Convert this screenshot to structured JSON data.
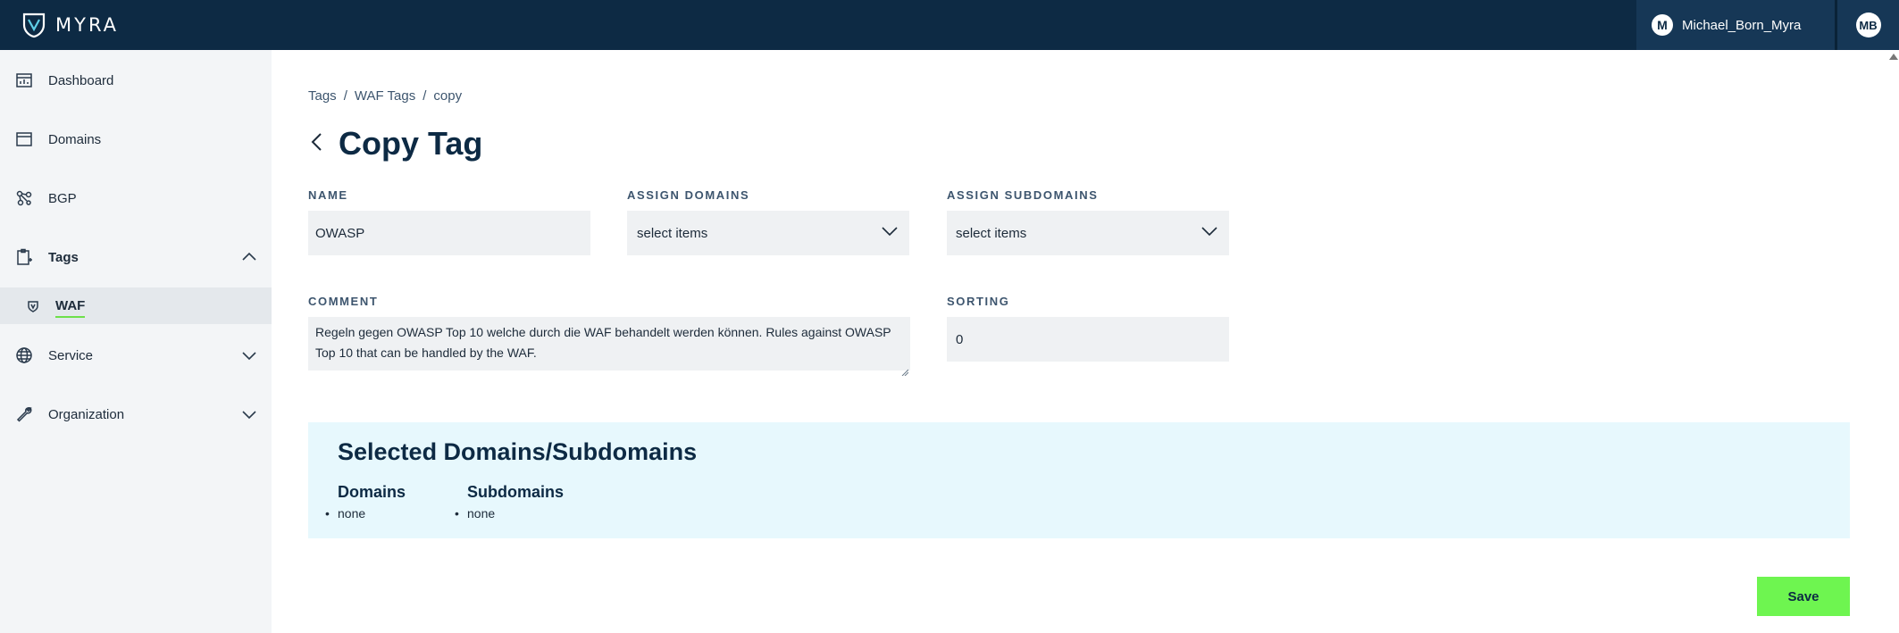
{
  "header": {
    "logo_text": "MYRA",
    "user_avatar_letter": "M",
    "user_name": "Michael_Born_Myra",
    "user_initials": "MB"
  },
  "sidebar": {
    "items": [
      {
        "label": "Dashboard",
        "icon": "dashboard-icon"
      },
      {
        "label": "Domains",
        "icon": "domains-icon"
      },
      {
        "label": "BGP",
        "icon": "bgp-icon"
      },
      {
        "label": "Tags",
        "icon": "tags-icon",
        "expanded": true
      },
      {
        "label": "Service",
        "icon": "service-icon",
        "expanded": false
      },
      {
        "label": "Organization",
        "icon": "organization-icon",
        "expanded": false
      }
    ],
    "sub_item": {
      "label": "WAF",
      "icon": "waf-icon"
    }
  },
  "breadcrumb": [
    "Tags",
    "WAF Tags",
    "copy"
  ],
  "page_title": "Copy Tag",
  "form": {
    "name_label": "NAME",
    "name_value": "OWASP",
    "assign_domains_label": "ASSIGN DOMAINS",
    "assign_domains_value": "select items",
    "assign_subdomains_label": "ASSIGN SUBDOMAINS",
    "assign_subdomains_value": "select items",
    "comment_label": "COMMENT",
    "comment_value": "Regeln gegen OWASP Top 10 welche durch die WAF behandelt werden können. Rules against OWASP Top 10 that can be handled by the WAF.",
    "sorting_label": "SORTING",
    "sorting_value": "0"
  },
  "selected": {
    "title": "Selected Domains/Subdomains",
    "domains_heading": "Domains",
    "domains_items": [
      "none"
    ],
    "subdomains_heading": "Subdomains",
    "subdomains_items": [
      "none"
    ]
  },
  "save_label": "Save",
  "colors": {
    "topbar": "#0d2a44",
    "accent_green": "#6ef550",
    "selected_bg": "#e7f8fd"
  }
}
